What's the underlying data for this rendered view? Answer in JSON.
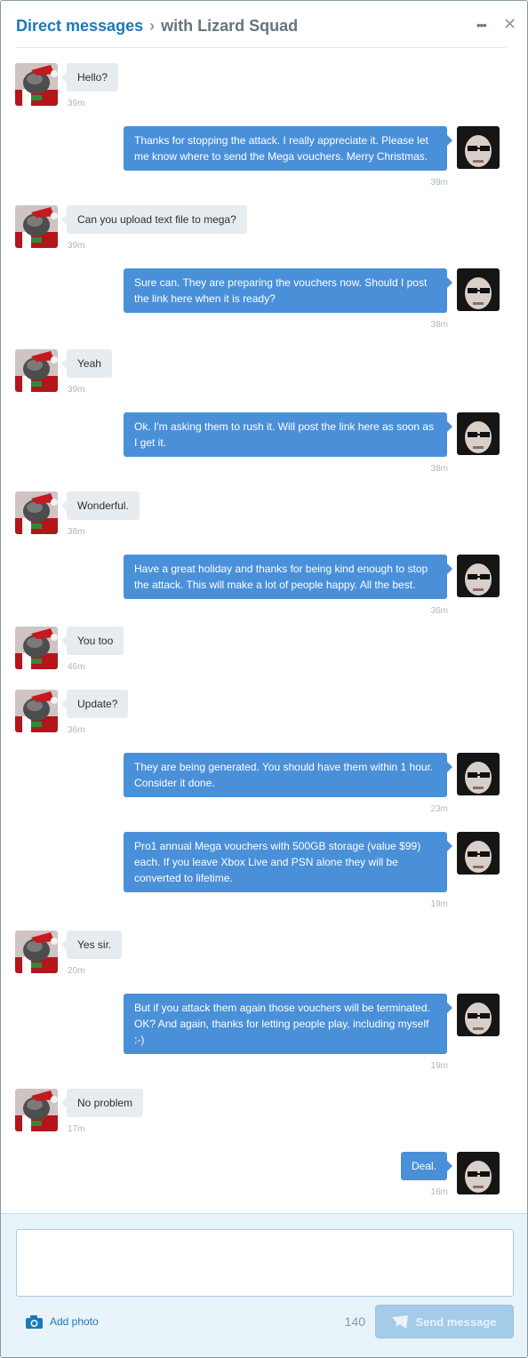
{
  "header": {
    "title_link": "Direct messages",
    "title_separator": "›",
    "title_rest": "with Lizard Squad",
    "more_glyph": "•••",
    "close_glyph": "✕"
  },
  "messages": [
    {
      "direction": "in",
      "text": "Hello?",
      "time": "39m"
    },
    {
      "direction": "out",
      "text": "Thanks for stopping the attack. I really appreciate it. Please let me know where to send the Mega vouchers. Merry Christmas.",
      "time": "39m"
    },
    {
      "direction": "in",
      "text": "Can you upload text file to mega?",
      "time": "39m"
    },
    {
      "direction": "out",
      "text": "Sure can. They are preparing the vouchers now. Should I post the link here when it is ready?",
      "time": "38m"
    },
    {
      "direction": "in",
      "text": "Yeah",
      "time": "39m"
    },
    {
      "direction": "out",
      "text": "Ok. I'm asking them to rush it. Will post the link here as soon as I get it.",
      "time": "38m"
    },
    {
      "direction": "in",
      "text": "Wonderful.",
      "time": "38m"
    },
    {
      "direction": "out",
      "text": "Have a great holiday and thanks for being kind enough to stop the attack. This will make a lot of people happy. All the best.",
      "time": "36m"
    },
    {
      "direction": "in",
      "text": "You too",
      "time": "46m"
    },
    {
      "direction": "in",
      "text": "Update?",
      "time": "36m"
    },
    {
      "direction": "out",
      "text": "They are being generated. You should have them within 1 hour. Consider it done.",
      "time": "23m"
    },
    {
      "direction": "out",
      "text": "Pro1 annual Mega vouchers with 500GB storage (value $99) each. If you leave Xbox Live and PSN alone they will be converted to lifetime.",
      "time": "19m"
    },
    {
      "direction": "in",
      "text": "Yes sir.",
      "time": "20m"
    },
    {
      "direction": "out",
      "text": "But if you attack them again those vouchers will be terminated. OK? And again, thanks for letting people play, including myself :-)",
      "time": "19m"
    },
    {
      "direction": "in",
      "text": "No problem",
      "time": "17m"
    },
    {
      "direction": "out",
      "text": "Deal.",
      "time": "16m"
    }
  ],
  "composer": {
    "text": "",
    "add_photo_label": "Add photo",
    "char_count": "140",
    "send_label": "Send message"
  },
  "colors": {
    "link": "#1b7ab8",
    "outgoing_bubble": "#4a90d9",
    "incoming_bubble": "#e6ecf0",
    "send_button_disabled": "#a4cbe8"
  }
}
